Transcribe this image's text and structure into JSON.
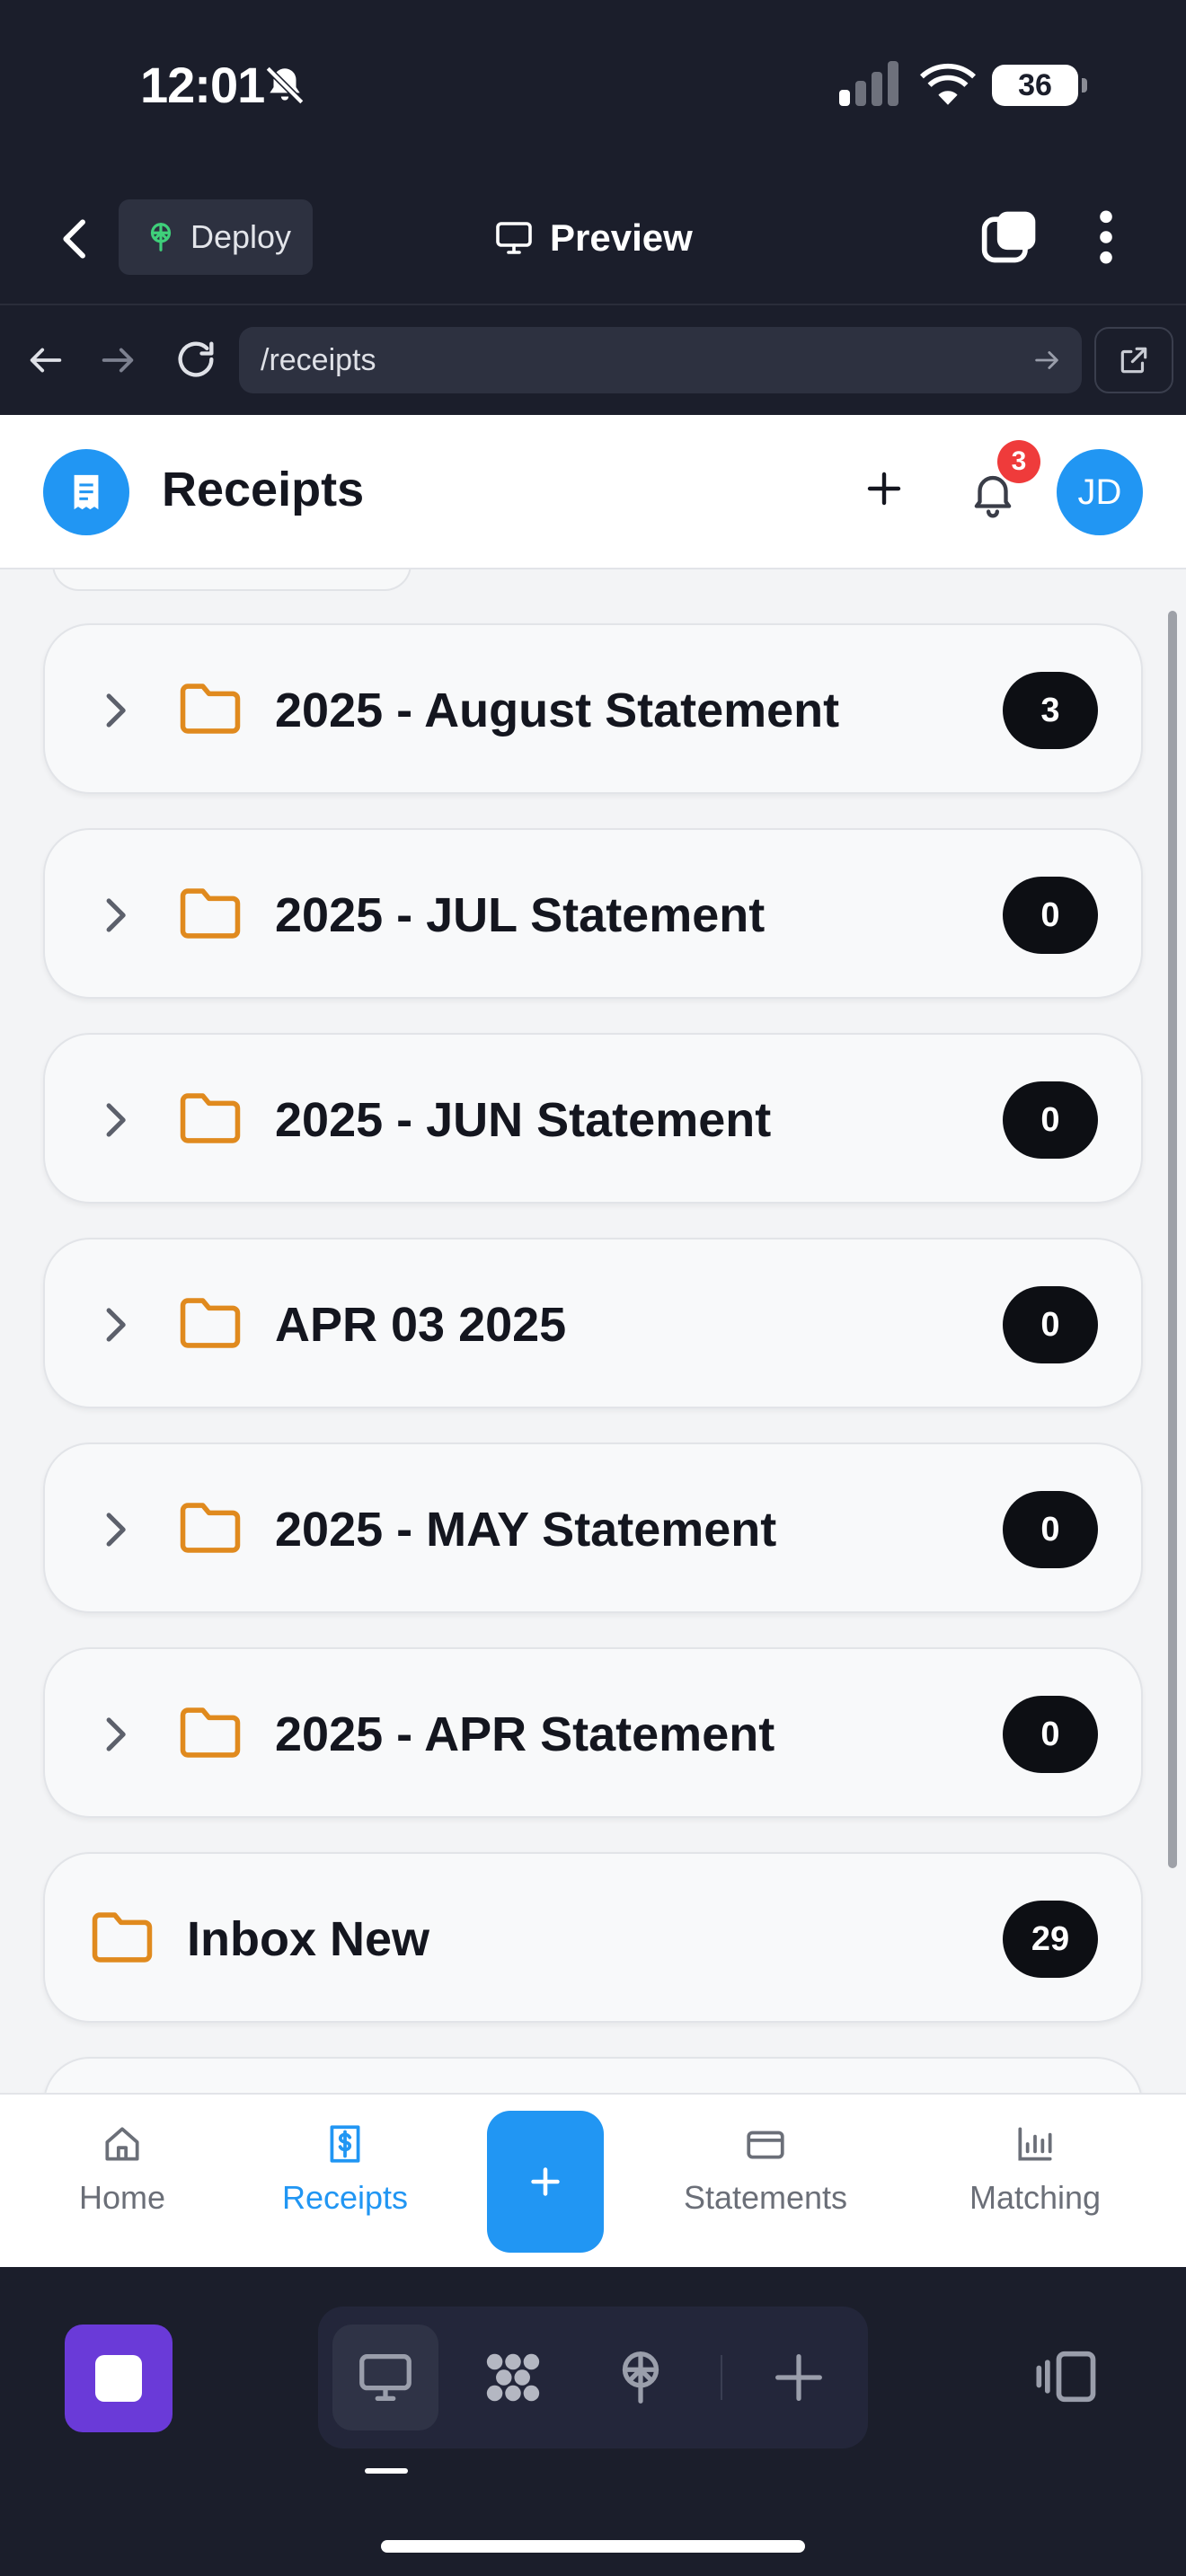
{
  "status_bar": {
    "time": "12:01",
    "battery": "36"
  },
  "app_header": {
    "deploy_label": "Deploy",
    "preview_label": "Preview"
  },
  "browser": {
    "url": "/receipts"
  },
  "page": {
    "title": "Receipts",
    "notification_count": "3",
    "avatar_initials": "JD"
  },
  "folders": [
    {
      "name": "2025 - August Statement",
      "count": "3",
      "expandable": true
    },
    {
      "name": "2025 - JUL Statement",
      "count": "0",
      "expandable": true
    },
    {
      "name": "2025 - JUN Statement",
      "count": "0",
      "expandable": true
    },
    {
      "name": "APR 03 2025",
      "count": "0",
      "expandable": true
    },
    {
      "name": "2025 - MAY Statement",
      "count": "0",
      "expandable": true
    },
    {
      "name": "2025 - APR Statement",
      "count": "0",
      "expandable": true
    },
    {
      "name": "Inbox New",
      "count": "29",
      "expandable": false
    }
  ],
  "tabbar": {
    "home": "Home",
    "receipts": "Receipts",
    "statements": "Statements",
    "matching": "Matching",
    "active": "receipts"
  },
  "colors": {
    "accent": "#2196f3",
    "folder": "#e08a1e",
    "badge": "#0d0f14",
    "notification": "#ef3b3b",
    "chrome": "#1b1e2b"
  }
}
